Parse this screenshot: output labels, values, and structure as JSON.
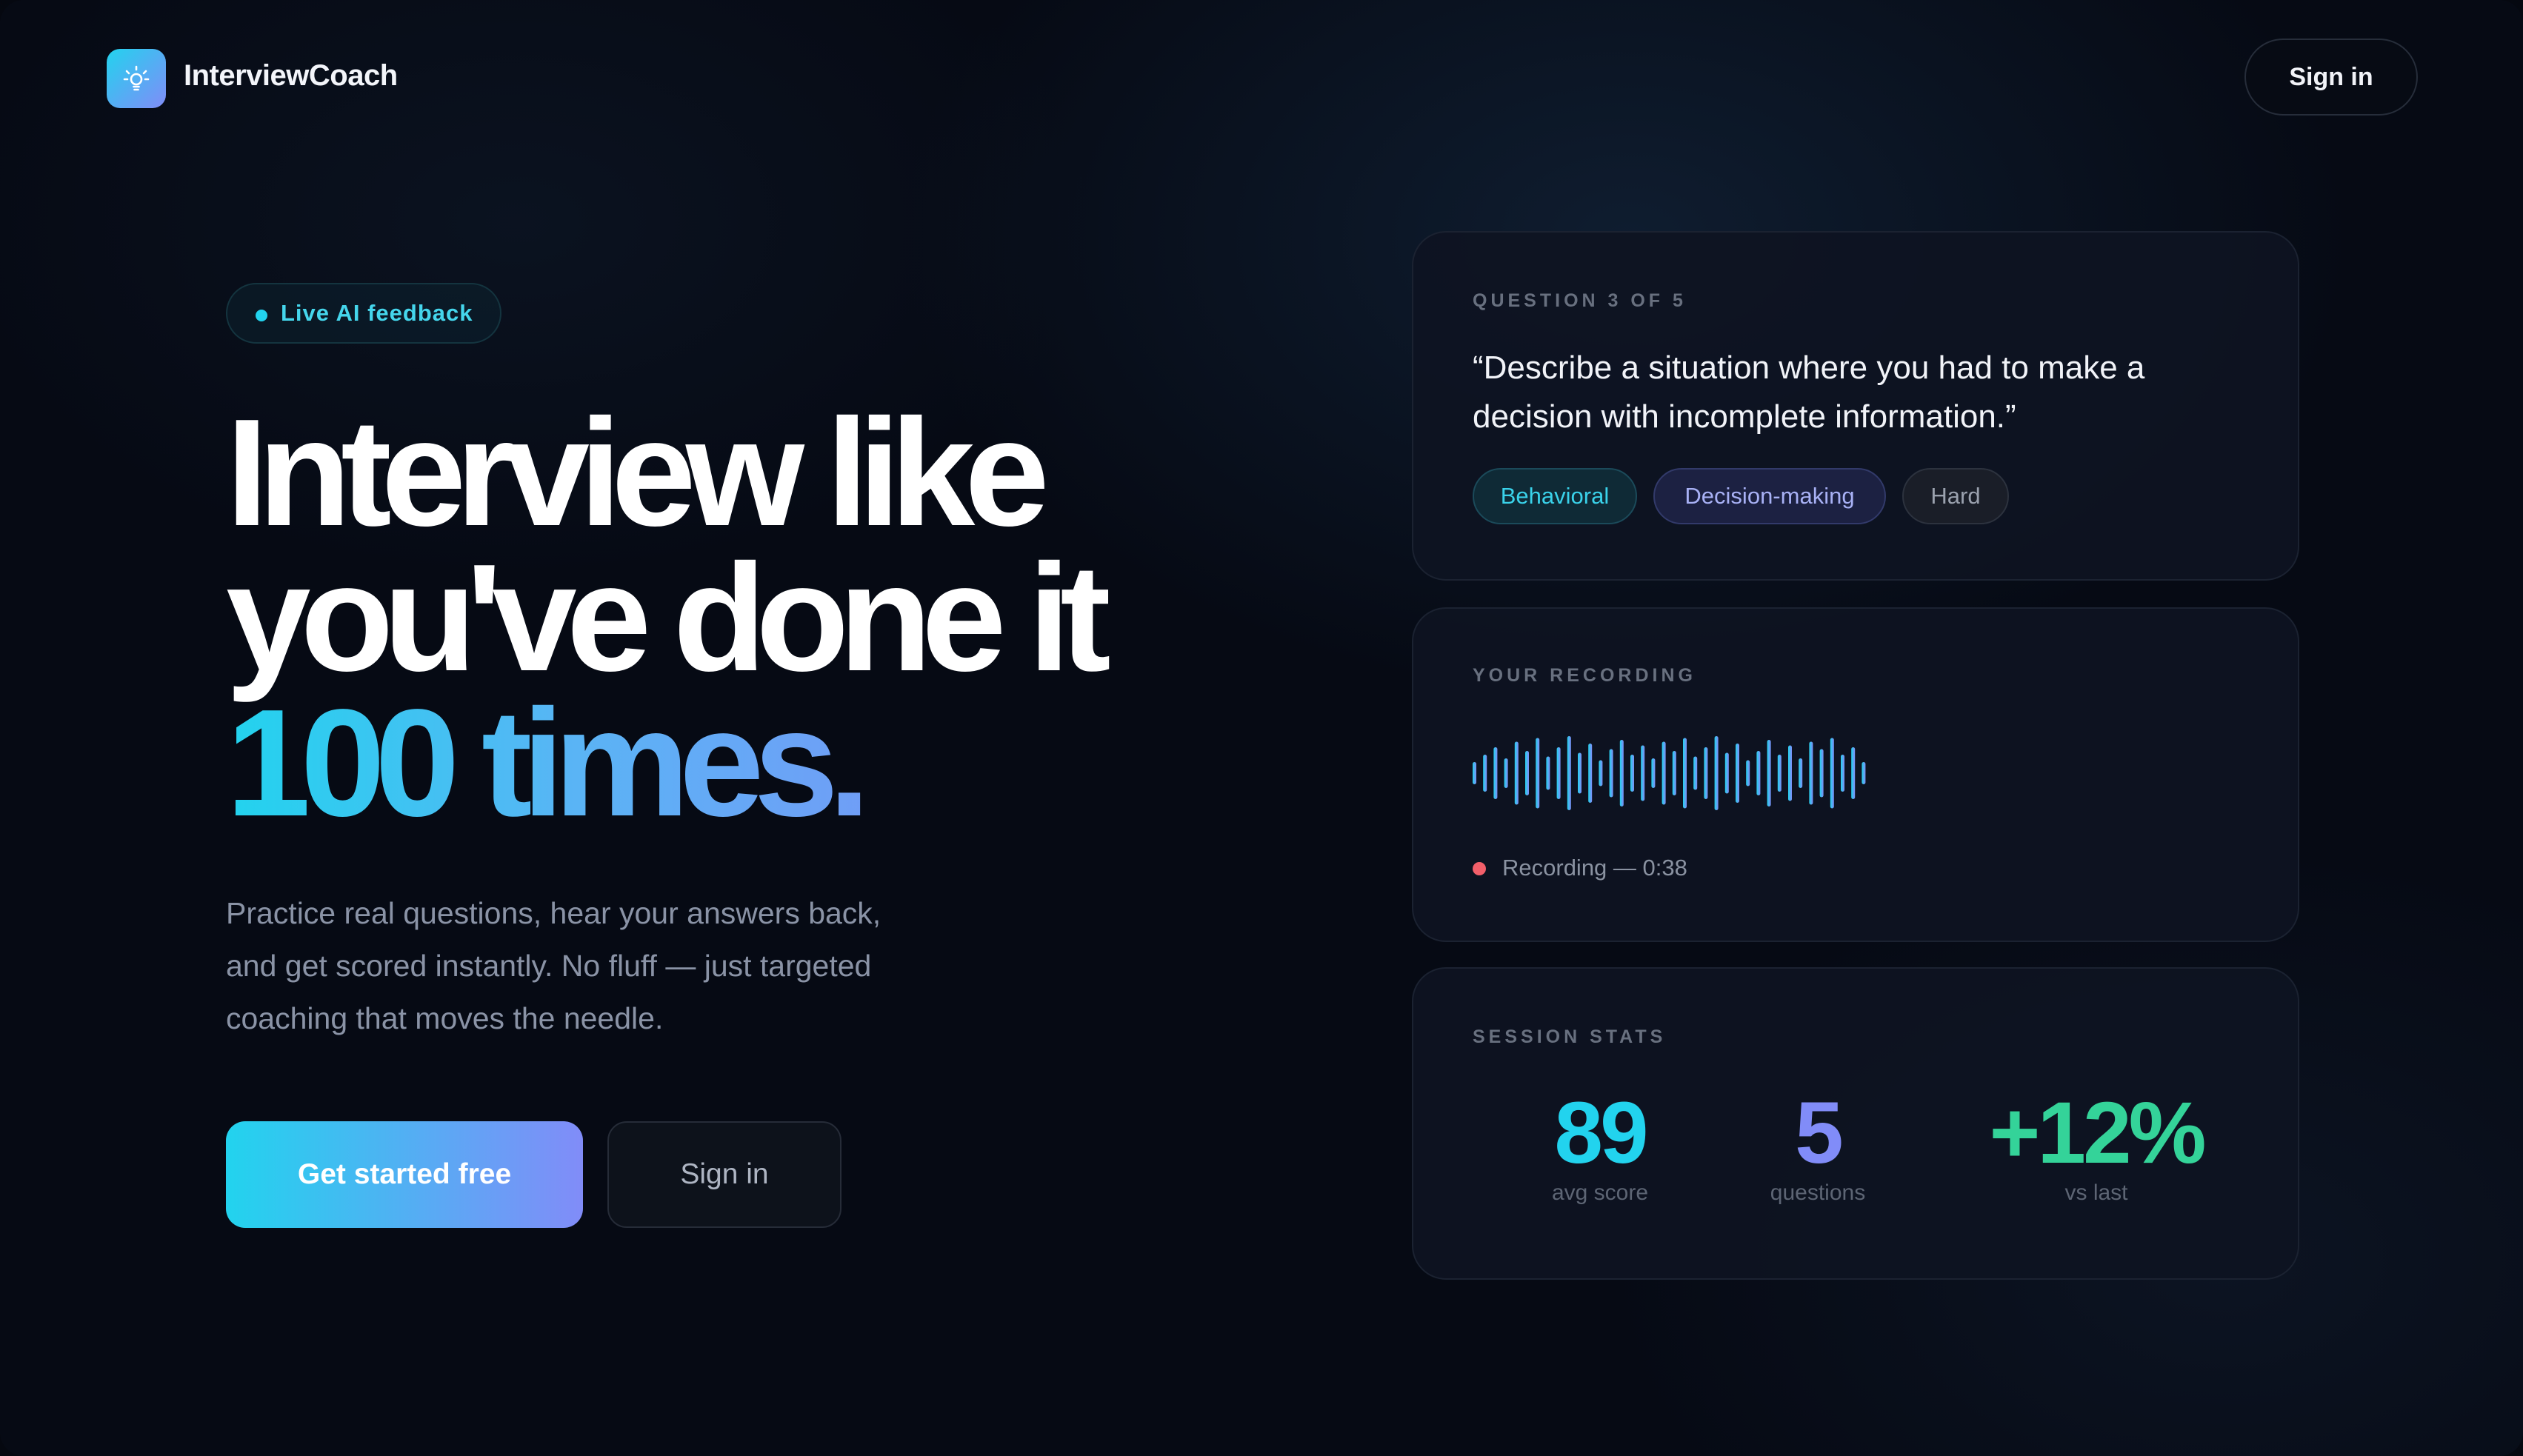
{
  "colors": {
    "accent_cyan": "#22d3ee",
    "accent_indigo": "#818cf8",
    "success_green": "#34d399",
    "recording_red": "#f25f6a",
    "background": "#060a14"
  },
  "header": {
    "logo_icon": "lightbulb-icon",
    "brand": "InterviewCoach",
    "signin_label": "Sign in"
  },
  "hero": {
    "badge": "Live AI feedback",
    "headline_line1": "Interview like",
    "headline_line2": "you've done it",
    "headline_line3": "100 times.",
    "subtext": "Practice real questions, hear your answers back, and get scored instantly. No fluff — just targeted coaching that moves the needle.",
    "primary_cta": "Get started free",
    "secondary_cta": "Sign in"
  },
  "question_card": {
    "label": "QUESTION 3 OF 5",
    "question": "“Describe a situation where you had to make a decision with incomplete information.”",
    "tags": [
      "Behavioral",
      "Decision-making",
      "Hard"
    ]
  },
  "recording_card": {
    "label": "YOUR RECORDING",
    "status": "Recording — 0:38"
  },
  "stats_card": {
    "label": "SESSION STATS",
    "stats": [
      {
        "value": "89",
        "label": "avg score"
      },
      {
        "value": "5",
        "label": "questions"
      },
      {
        "value": "+12%",
        "label": "vs last"
      }
    ]
  }
}
